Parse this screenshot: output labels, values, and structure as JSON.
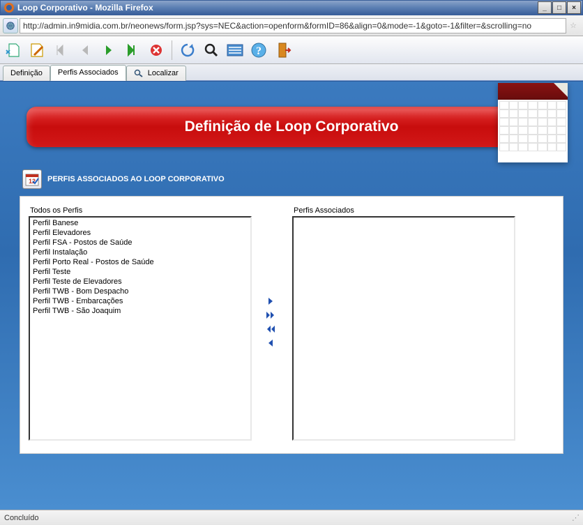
{
  "window": {
    "title": "Loop Corporativo - Mozilla Firefox"
  },
  "address": {
    "url": "http://admin.in9midia.com.br/neonews/form.jsp?sys=NEC&action=openform&formID=86&align=0&mode=-1&goto=-1&filter=&scrolling=no"
  },
  "tabs": {
    "items": [
      {
        "label": "Definição"
      },
      {
        "label": "Perfis Associados"
      },
      {
        "label": "Localizar"
      }
    ]
  },
  "banner": {
    "title": "Definição de Loop Corporativo"
  },
  "section": {
    "heading": "PERFIS ASSOCIADOS AO LOOP CORPORATIVO"
  },
  "lists": {
    "all_label": "Todos os Perfis",
    "assoc_label": "Perfis Associados",
    "all_items": [
      "Perfil Banese",
      "Perfil Elevadores",
      "Perfil FSA - Postos de Saúde",
      "Perfil Instalação",
      "Perfil Porto Real - Postos de Saúde",
      "Perfil Teste",
      "Perfil Teste de Elevadores",
      "Perfil TWB - Bom Despacho",
      "Perfil TWB - Embarcações",
      "Perfil TWB - São Joaquim"
    ],
    "assoc_items": []
  },
  "status": {
    "text": "Concluído"
  }
}
